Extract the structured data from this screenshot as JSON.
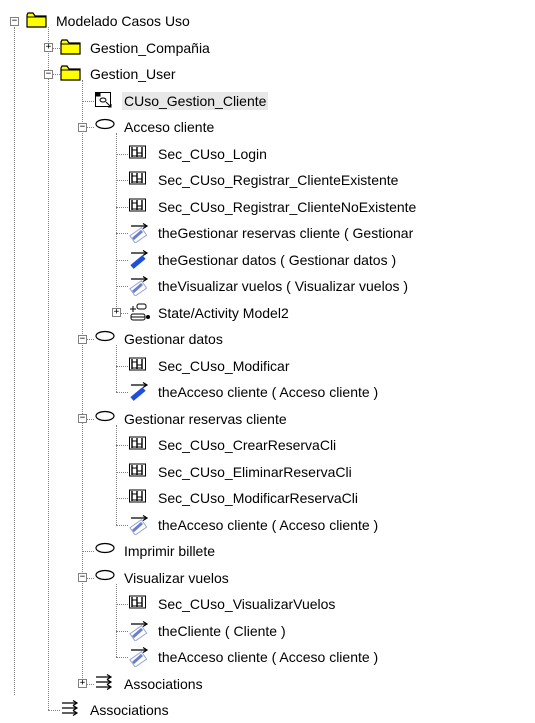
{
  "tree": {
    "nodes": [
      {
        "name": "root-folder",
        "label": "Modelado Casos Uso",
        "icon": "folder-icon",
        "depth": 0,
        "expander": "minus"
      },
      {
        "name": "folder-gestion-compania",
        "label": "Gestion_Compañia",
        "icon": "folder-icon",
        "depth": 1,
        "expander": "plus"
      },
      {
        "name": "folder-gestion-user",
        "label": "Gestion_User",
        "icon": "folder-icon",
        "depth": 1,
        "expander": "minus"
      },
      {
        "name": "diagram-cuso-gestion-cliente",
        "label": "CUso_Gestion_Cliente",
        "icon": "use-case-diagram-icon",
        "depth": 2,
        "expander": "none",
        "selected": true
      },
      {
        "name": "usecase-acceso-cliente",
        "label": "Acceso cliente",
        "icon": "use-case-ellipse-icon",
        "depth": 2,
        "expander": "minus"
      },
      {
        "name": "seq-cuso-login",
        "label": "Sec_CUso_Login",
        "icon": "sequence-diagram-icon",
        "depth": 3,
        "expander": "none"
      },
      {
        "name": "seq-registrar-existente",
        "label": "Sec_CUso_Registrar_ClienteExistente",
        "icon": "sequence-diagram-icon",
        "depth": 3,
        "expander": "none"
      },
      {
        "name": "seq-registrar-noexistente",
        "label": "Sec_CUso_Registrar_ClienteNoExistente",
        "icon": "sequence-diagram-icon",
        "depth": 3,
        "expander": "none"
      },
      {
        "name": "assoc-gestionar-reservas",
        "label": "theGestionar reservas cliente ( Gestionar",
        "icon": "association-arrow-icon",
        "depth": 3,
        "expander": "none"
      },
      {
        "name": "assoc-gestionar-datos",
        "label": "theGestionar datos ( Gestionar datos )",
        "icon": "association-arrow-blue-icon",
        "depth": 3,
        "expander": "none"
      },
      {
        "name": "assoc-visualizar-vuelos",
        "label": "theVisualizar vuelos ( Visualizar vuelos )",
        "icon": "association-arrow-icon",
        "depth": 3,
        "expander": "none"
      },
      {
        "name": "state-activity-model2",
        "label": "State/Activity Model2",
        "icon": "state-activity-model-icon",
        "depth": 3,
        "expander": "plus"
      },
      {
        "name": "usecase-gestionar-datos",
        "label": "Gestionar datos",
        "icon": "use-case-ellipse-icon",
        "depth": 2,
        "expander": "minus"
      },
      {
        "name": "seq-cuso-modificar",
        "label": "Sec_CUso_Modificar",
        "icon": "sequence-diagram-icon",
        "depth": 3,
        "expander": "none"
      },
      {
        "name": "assoc-acceso-cliente-1",
        "label": "theAcceso cliente ( Acceso cliente )",
        "icon": "association-arrow-blue-icon",
        "depth": 3,
        "expander": "none"
      },
      {
        "name": "usecase-gestionar-reservas",
        "label": "Gestionar reservas cliente",
        "icon": "use-case-ellipse-icon",
        "depth": 2,
        "expander": "minus"
      },
      {
        "name": "seq-crear-reserva",
        "label": "Sec_CUso_CrearReservaCli",
        "icon": "sequence-diagram-icon",
        "depth": 3,
        "expander": "none"
      },
      {
        "name": "seq-eliminar-reserva",
        "label": "Sec_CUso_EliminarReservaCli",
        "icon": "sequence-diagram-icon",
        "depth": 3,
        "expander": "none"
      },
      {
        "name": "seq-modificar-reserva",
        "label": "Sec_CUso_ModificarReservaCli",
        "icon": "sequence-diagram-icon",
        "depth": 3,
        "expander": "none"
      },
      {
        "name": "assoc-acceso-cliente-2",
        "label": "theAcceso cliente ( Acceso cliente )",
        "icon": "association-arrow-icon",
        "depth": 3,
        "expander": "none"
      },
      {
        "name": "usecase-imprimir-billete",
        "label": "Imprimir billete",
        "icon": "use-case-ellipse-icon",
        "depth": 2,
        "expander": "none"
      },
      {
        "name": "usecase-visualizar-vuelos",
        "label": "Visualizar vuelos",
        "icon": "use-case-ellipse-icon",
        "depth": 2,
        "expander": "minus"
      },
      {
        "name": "seq-visualizar-vuelos",
        "label": "Sec_CUso_VisualizarVuelos",
        "icon": "sequence-diagram-icon",
        "depth": 3,
        "expander": "none"
      },
      {
        "name": "assoc-the-cliente",
        "label": "theCliente ( Cliente )",
        "icon": "association-arrow-icon",
        "depth": 3,
        "expander": "none"
      },
      {
        "name": "assoc-acceso-cliente-3",
        "label": "theAcceso cliente ( Acceso cliente )",
        "icon": "association-arrow-icon",
        "depth": 3,
        "expander": "none"
      },
      {
        "name": "associations-gestion-user",
        "label": "Associations",
        "icon": "associations-icon",
        "depth": 2,
        "expander": "plus"
      },
      {
        "name": "associations-root",
        "label": "Associations",
        "icon": "associations-icon",
        "depth": 1,
        "expander": "none"
      }
    ]
  },
  "colors": {
    "folder_fill": "#ffff00",
    "folder_outline": "#000000",
    "tree_line": "#808080",
    "selection": "#e8e8e8",
    "association_blue": "#1f4fd8"
  }
}
